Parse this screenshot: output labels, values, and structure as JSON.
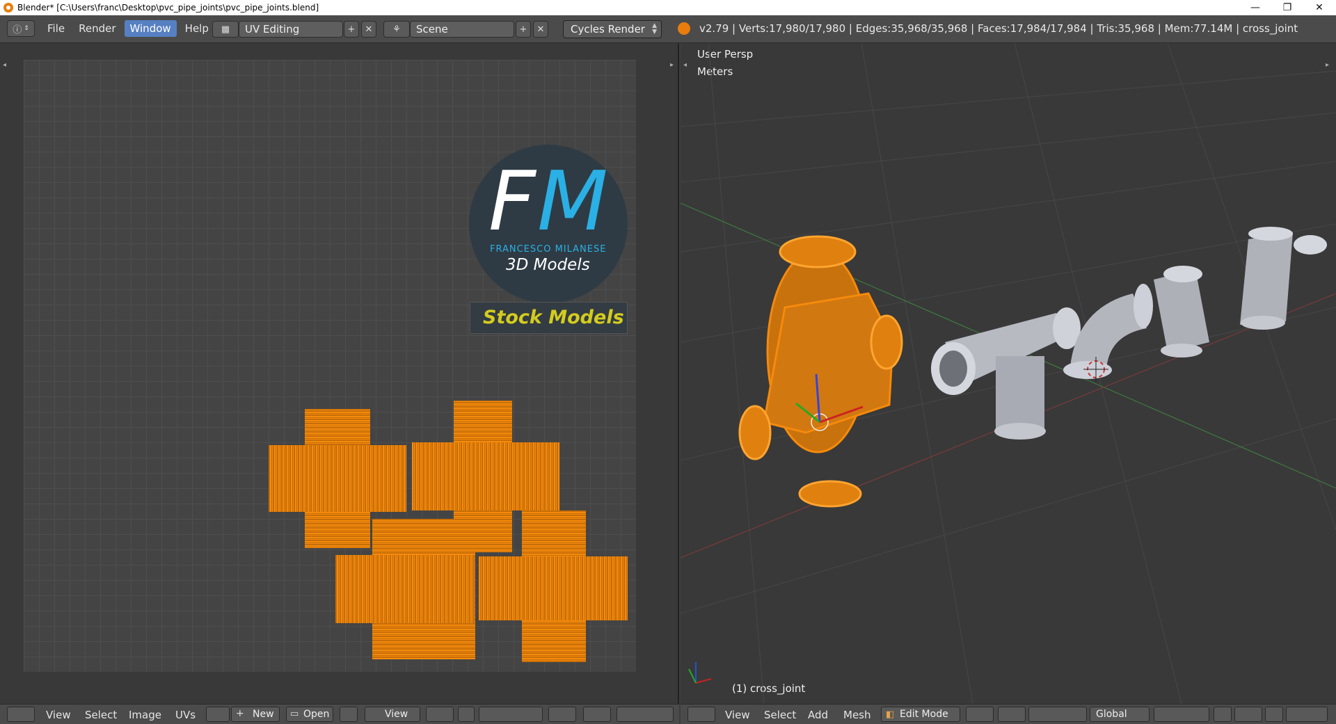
{
  "window": {
    "title": "Blender* [C:\\Users\\franc\\Desktop\\pvc_pipe_joints\\pvc_pipe_joints.blend]",
    "controls": [
      "—",
      "❐",
      "✕"
    ]
  },
  "menu": {
    "items": [
      "File",
      "Render",
      "Window",
      "Help"
    ],
    "active": "Window"
  },
  "layout": {
    "screen": "UV Editing",
    "scene": "Scene",
    "engine": "Cycles Render"
  },
  "stats": "v2.79 | Verts:17,980/17,980 | Edges:35,968/35,968 | Faces:17,984/17,984 | Tris:35,968 | Mem:77.14M | cross_joint",
  "uv_editor": {
    "logo": {
      "initial_f": "F",
      "initial_m": "M",
      "subtitle": "FRANCESCO MILANESE",
      "tagline": "3D Models",
      "banner": "Stock Models"
    },
    "bottom": {
      "view": "View",
      "select": "Select",
      "image": "Image",
      "uvs": "UVs",
      "new": "New",
      "open": "Open",
      "view2": "View"
    }
  },
  "viewport": {
    "persp_label": "User Persp",
    "units_label": "Meters",
    "object_label": "(1) cross_joint",
    "bottom": {
      "view": "View",
      "select": "Select",
      "add": "Add",
      "mesh": "Mesh",
      "mode": "Edit Mode",
      "orientation": "Global"
    }
  },
  "colors": {
    "accent": "#5680c2",
    "selection": "#f58a0c",
    "logo_blue": "#2ab0e4",
    "logo_yellow": "#d4cc1e"
  }
}
